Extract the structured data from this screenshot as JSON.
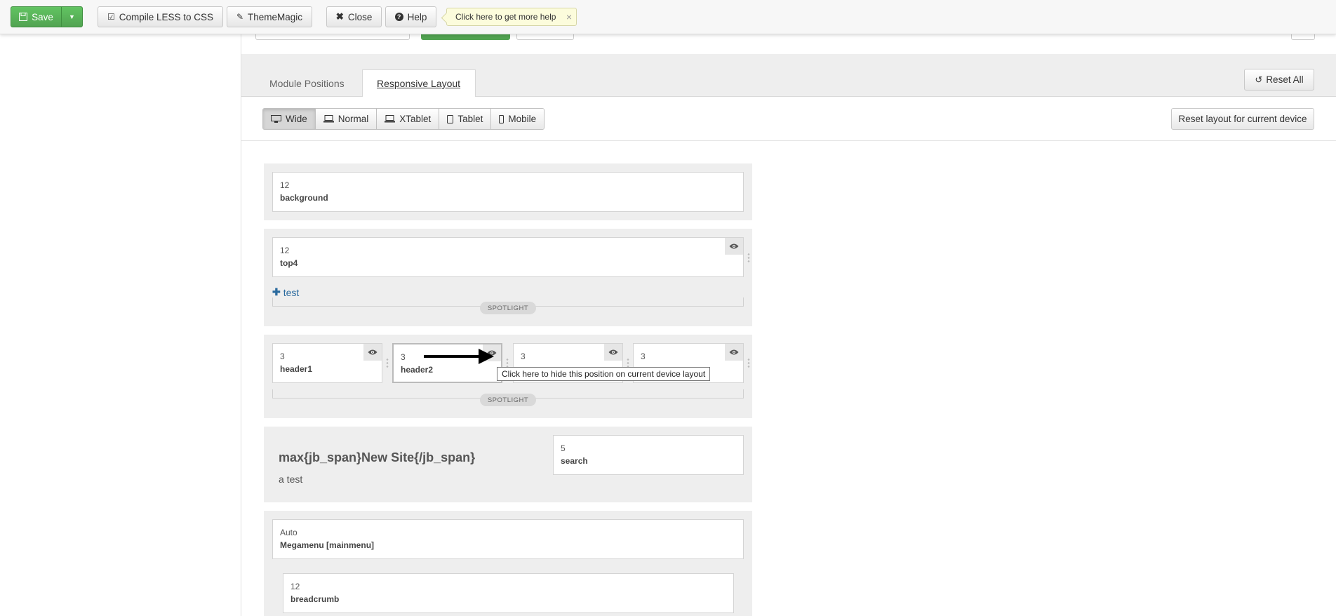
{
  "toolbar": {
    "save_label": "Save",
    "compile_label": "Compile LESS to CSS",
    "thememagic_label": "ThemeMagic",
    "close_label": "Close",
    "help_label": "Help",
    "help_tip": "Click here to get more help",
    "help_tip_close": "×"
  },
  "tabs": {
    "module_positions": "Module Positions",
    "responsive_layout": "Responsive Layout",
    "reset_all": "Reset All"
  },
  "devices": {
    "wide": "Wide",
    "normal": "Normal",
    "xtablet": "XTablet",
    "tablet": "Tablet",
    "mobile": "Mobile",
    "reset_device": "Reset layout for current device"
  },
  "layout": {
    "background": {
      "span": "12",
      "name": "background"
    },
    "top4": {
      "span": "12",
      "name": "top4"
    },
    "add_link": "test",
    "spotlight_label": "SPOTLIGHT",
    "header1": {
      "span": "3",
      "name": "header1"
    },
    "header2": {
      "span": "3",
      "name": "header2"
    },
    "header3": {
      "span": "3"
    },
    "header4": {
      "span": "3"
    },
    "hide_tooltip": "Click here to hide this position on current device layout",
    "logo_title": "max{jb_span}New Site{/jb_span}",
    "logo_sub": "a test",
    "search": {
      "span": "5",
      "name": "search"
    },
    "megamenu": {
      "span": "Auto",
      "name": "Megamenu [mainmenu]"
    },
    "breadcrumb": {
      "span": "12",
      "name": "breadcrumb"
    }
  },
  "colors": {
    "save_green": "#51a351",
    "link_blue": "#2a6a9e",
    "section_grey": "#eeeeee"
  }
}
